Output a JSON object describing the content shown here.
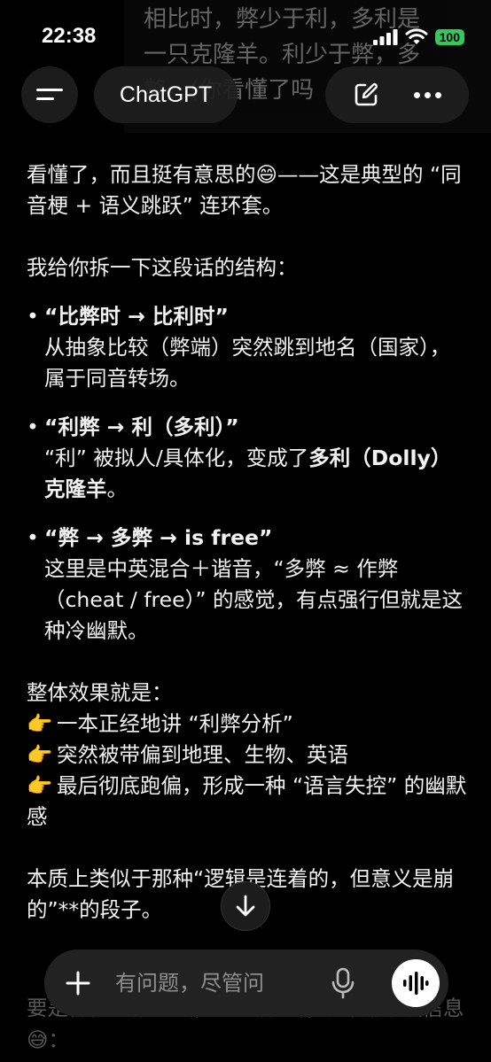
{
  "status": {
    "time": "22:38",
    "battery": "100"
  },
  "header": {
    "title": "ChatGPT"
  },
  "under_text": {
    "line1": "相比时，弊少于利，多利是",
    "line2": "一只克隆羊。利少于弊，多",
    "line3": "弊。(你看懂了吗"
  },
  "message": {
    "intro": "看懂了，而且挺有意思的😄——这是典型的 “同音梗 + 语义跳跃” 连环套。",
    "breakdown_lead": "我给你拆一下这段话的结构：",
    "bullets": [
      {
        "title": "“比弊时 → 比利时”",
        "body": "从抽象比较（弊端）突然跳到地名（国家），属于同音转场。"
      },
      {
        "title": "“利弊 → 利（多利）”",
        "body_plain": "“利” 被拟人/具体化，变成了",
        "body_bold": "多利（Dolly）克隆羊",
        "body_end": "。"
      },
      {
        "title": "“弊 → 多弊 → is free”",
        "body": "这里是中英混合＋谐音，“多弊 ≈ 作弊（cheat / free）” 的感觉，有点强行但就是这种冷幽默。"
      }
    ],
    "effect_lead": "整体效果就是：",
    "points": [
      {
        "icon": "👉",
        "text": "一本正经地讲 “利弊分析”"
      },
      {
        "icon": "👉",
        "text": "突然被带偏到地理、生物、英语"
      },
      {
        "icon": "👉",
        "text": "最后彻底跑偏，形成一种 “语言失控” 的幽默感"
      }
    ],
    "essence": "本质上类似于那种“逻辑是连着的，但意义是崩的”**的段子。",
    "faded_tail": "要是再往上推一层，其实有点像编译器错误信息😅："
  },
  "composer": {
    "placeholder": "有问题，尽管问"
  }
}
